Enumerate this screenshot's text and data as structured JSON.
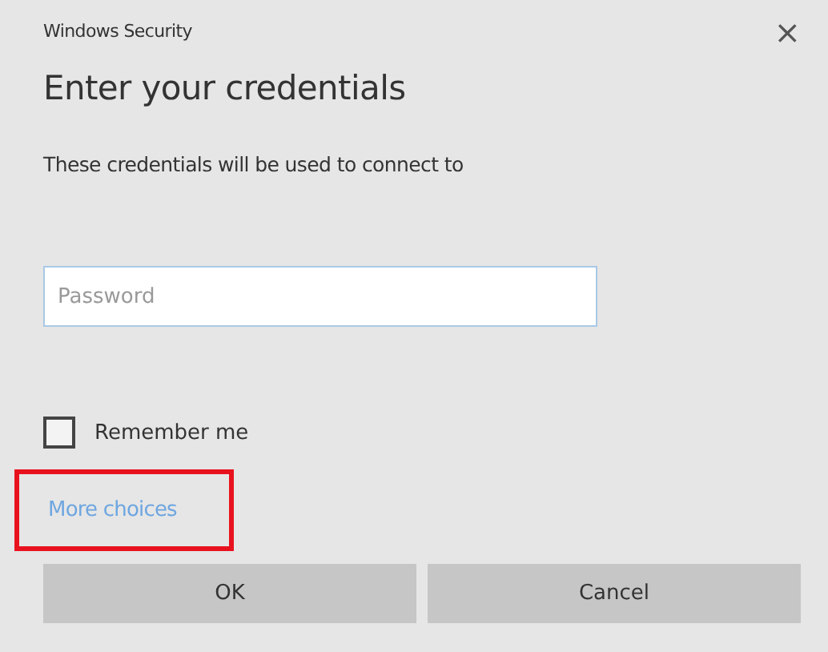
{
  "window": {
    "title": "Windows Security",
    "close": "×"
  },
  "heading": "Enter your credentials",
  "message": "These credentials will be used to connect to",
  "password": {
    "placeholder": "Password"
  },
  "remember": {
    "label": "Remember me",
    "checked": false
  },
  "more_choices": {
    "label": "More choices",
    "highlighted": true
  },
  "buttons": [
    {
      "label": "OK"
    },
    {
      "label": "Cancel"
    }
  ]
}
